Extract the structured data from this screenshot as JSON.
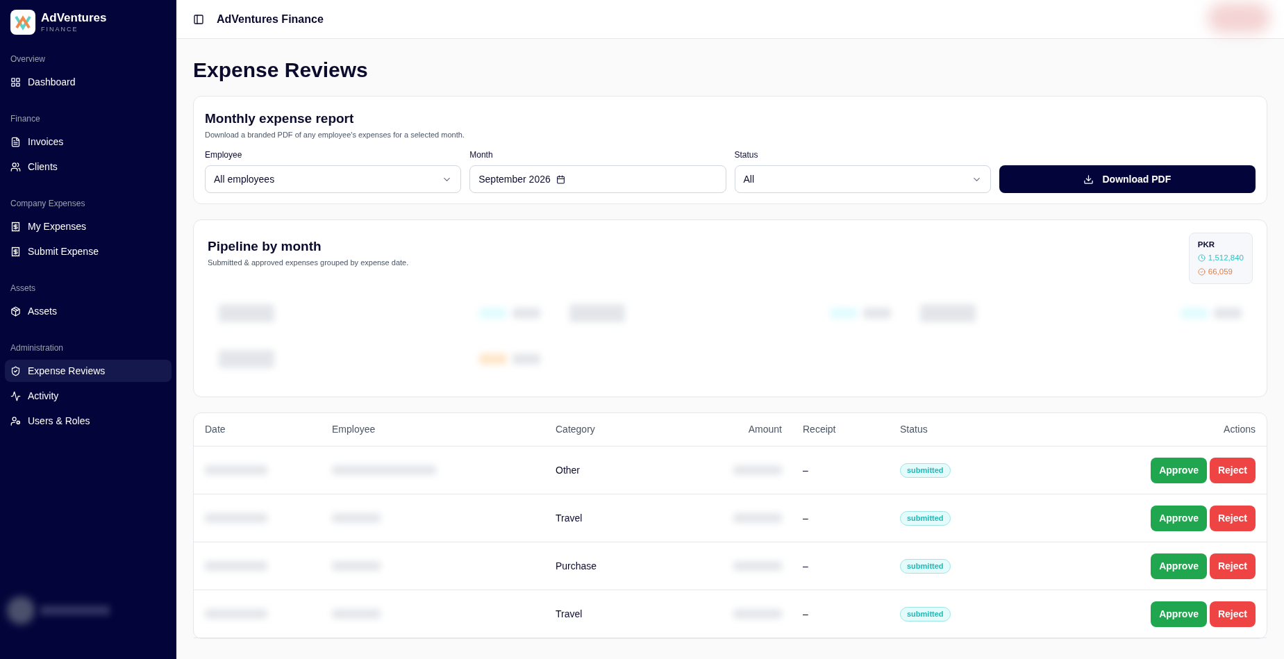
{
  "brand": {
    "name": "AdVentures",
    "tagline": "FINANCE"
  },
  "sidebar": {
    "sections": [
      {
        "title": "Overview",
        "items": [
          {
            "label": "Dashboard",
            "kind": "dashboard",
            "selected": false
          }
        ]
      },
      {
        "title": "Finance",
        "items": [
          {
            "label": "Invoices",
            "kind": "file",
            "selected": false
          },
          {
            "label": "Clients",
            "kind": "users",
            "selected": false
          }
        ]
      },
      {
        "title": "Company Expenses",
        "items": [
          {
            "label": "My Expenses",
            "kind": "receipt",
            "selected": false
          },
          {
            "label": "Submit Expense",
            "kind": "receipt",
            "selected": false
          }
        ]
      },
      {
        "title": "Assets",
        "items": [
          {
            "label": "Assets",
            "kind": "box",
            "selected": false
          }
        ]
      },
      {
        "title": "Administration",
        "items": [
          {
            "label": "Expense Reviews",
            "kind": "shield",
            "selected": true
          },
          {
            "label": "Activity",
            "kind": "activity",
            "selected": false
          },
          {
            "label": "Users & Roles",
            "kind": "usercog",
            "selected": false
          }
        ]
      }
    ]
  },
  "header": {
    "title": "AdVentures Finance"
  },
  "page_title": "Expense Reviews",
  "report": {
    "title": "Monthly expense report",
    "subtitle": "Download a branded PDF of any employee's expenses for a selected month.",
    "fields": [
      {
        "label": "Employee",
        "kind": "select",
        "value": "All employees"
      },
      {
        "label": "Month",
        "kind": "month",
        "value": "September 2026"
      },
      {
        "label": "Status",
        "kind": "select",
        "value": "All"
      }
    ],
    "button": "Download PDF"
  },
  "pipeline": {
    "title": "Pipeline by month",
    "subtitle": "Submitted & approved expenses grouped by expense date.",
    "currency": "PKR",
    "submitted_total": "1,512,840",
    "approved_total": "66,059"
  },
  "table": {
    "columns": [
      "Date",
      "Employee",
      "Category",
      "Amount",
      "Receipt",
      "Status",
      "Actions"
    ],
    "rows": [
      {
        "category": "Other",
        "receipt": "–",
        "status": "submitted",
        "approve": "Approve",
        "reject": "Reject"
      },
      {
        "category": "Travel",
        "receipt": "–",
        "status": "submitted",
        "approve": "Approve",
        "reject": "Reject"
      },
      {
        "category": "Purchase",
        "receipt": "–",
        "status": "submitted",
        "approve": "Approve",
        "reject": "Reject"
      },
      {
        "category": "Travel",
        "receipt": "–",
        "status": "submitted",
        "approve": "Approve",
        "reject": "Reject"
      }
    ]
  }
}
